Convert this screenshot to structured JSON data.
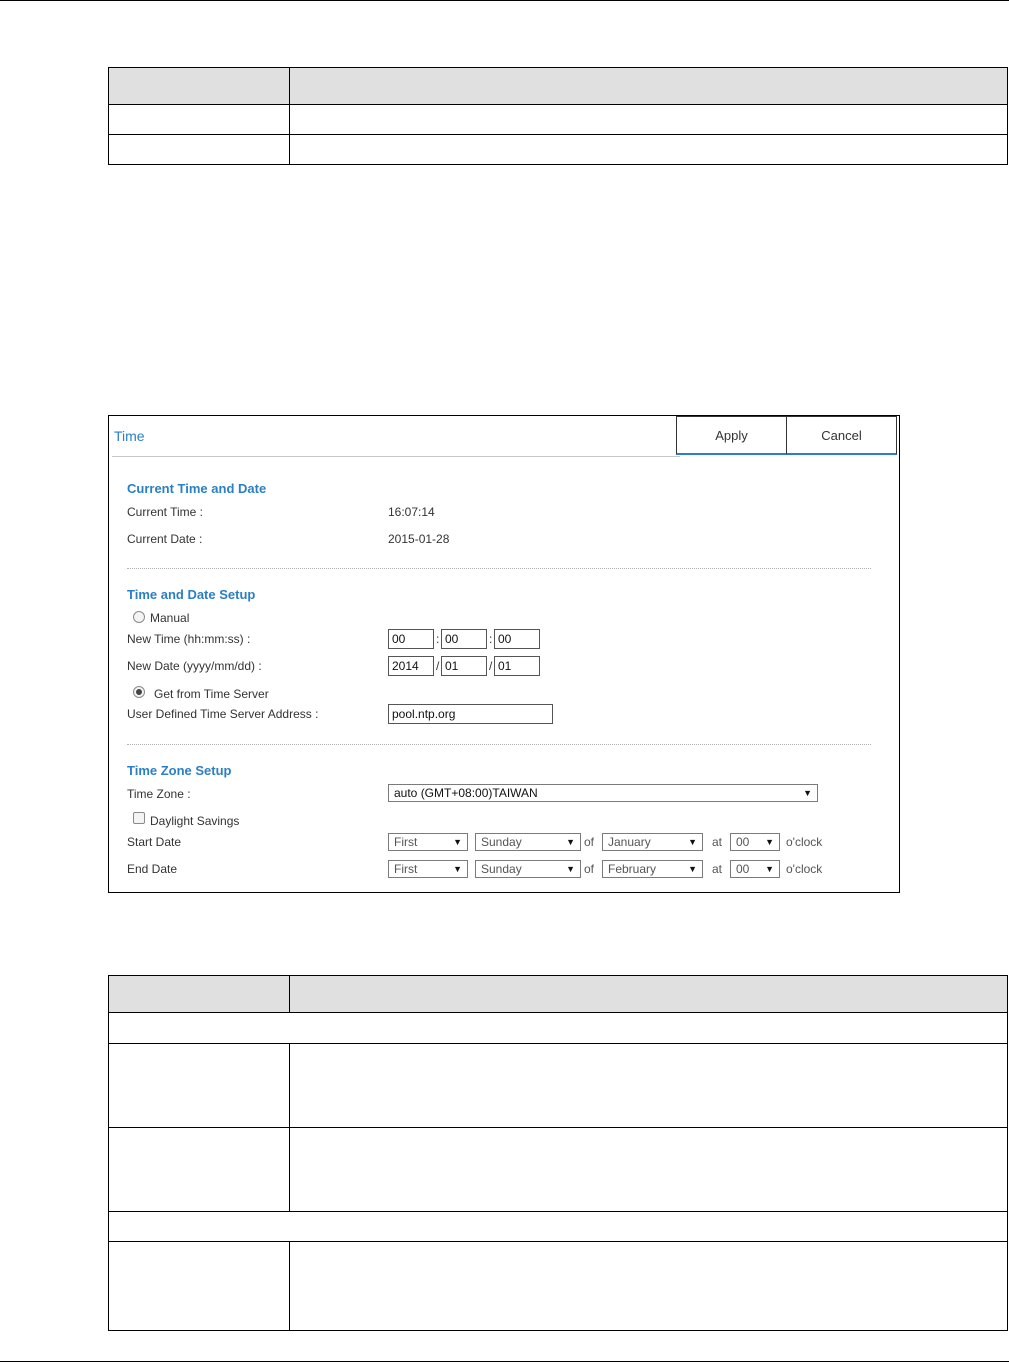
{
  "panel": {
    "title": "Time",
    "apply_label": "Apply",
    "cancel_label": "Cancel"
  },
  "current": {
    "title": "Current Time and Date",
    "time_label": "Current Time :",
    "time_value": "16:07:14",
    "date_label": "Current Date :",
    "date_value": "2015-01-28"
  },
  "setup": {
    "title": "Time and Date Setup",
    "manual_label": "Manual",
    "new_time_label": "New Time (hh:mm:ss) :",
    "hh": "00",
    "mm": "00",
    "ss": "00",
    "time_sep": ":",
    "new_date_label": "New Date (yyyy/mm/dd) :",
    "yyyy": "2014",
    "month": "01",
    "day": "01",
    "date_sep": "/",
    "server_label": "Get from Time Server",
    "server_addr_label": "User Defined Time Server Address :",
    "server_addr": "pool.ntp.org",
    "selected_mode": "Get from Time Server"
  },
  "zone": {
    "title": "Time Zone Setup",
    "zone_label": "Time Zone :",
    "zone_value": "auto (GMT+08:00)TAIWAN",
    "dst_label": "Daylight Savings",
    "dst_checked": false,
    "start_label": "Start Date",
    "end_label": "End Date",
    "start": {
      "week": "First",
      "day": "Sunday",
      "month": "January",
      "hour": "00"
    },
    "end": {
      "week": "First",
      "day": "Sunday",
      "month": "February",
      "hour": "00"
    },
    "of_text": "of",
    "at_text": "at",
    "oclock_text": "o'clock"
  },
  "colors": {
    "accent": "#2b7fc4",
    "table_header": "#e0e0e0"
  },
  "icons": {
    "dropdown": "dropdown-arrow-icon"
  }
}
